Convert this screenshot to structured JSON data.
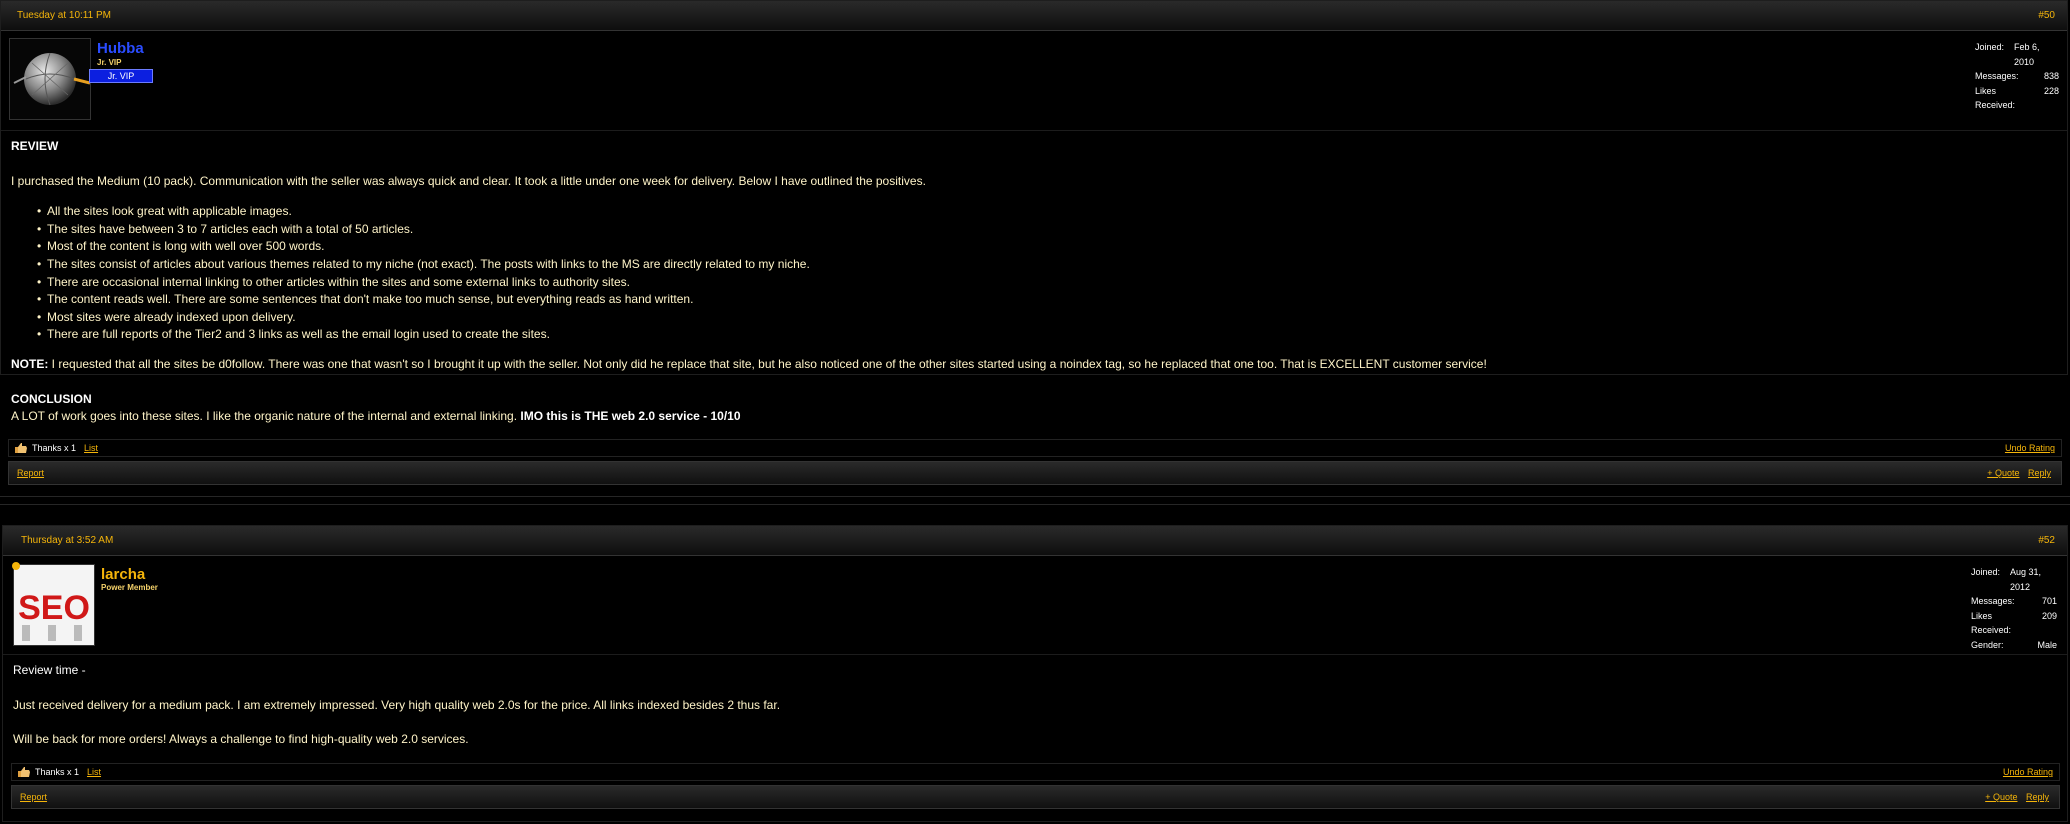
{
  "posts": [
    {
      "date": "Tuesday at 10:11 PM",
      "number": "#50",
      "username": "Hubba",
      "username_color": "#2a4cff",
      "user_title": "Jr. VIP",
      "rank_badge": "Jr. VIP",
      "stats": [
        {
          "label": "Joined:",
          "value": "Feb 6, 2010"
        },
        {
          "label": "Messages:",
          "value": "838"
        },
        {
          "label": "Likes Received:",
          "value": "228"
        }
      ],
      "review_heading": "REVIEW",
      "intro": "I purchased the Medium (10 pack). Communication with the seller was always quick and clear. It took a little under one week for delivery. Below I have outlined the positives.",
      "positives": [
        "All the sites look great with applicable images.",
        "The sites have between 3 to 7 articles each with a total of 50 articles.",
        "Most of the content is long with well over 500 words.",
        "The sites consist of articles about various themes related to my niche (not exact). The posts with links to the MS are directly related to my niche.",
        "There are occasional internal linking to other articles within the sites and some external links to authority sites.",
        "The content reads well. There are some sentences that don't make too much sense, but everything reads as hand written.",
        "Most sites were already indexed upon delivery.",
        "There are full reports of the Tier2 and 3 links as well as the email login used to create the sites."
      ],
      "note_label": "NOTE:",
      "note_text": " I requested that all the sites be d0follow. There was one that wasn't so I brought it up with the seller. Not only did he replace that site, but he also noticed one of the other sites started using a noindex tag, so he replaced that one too. That is EXCELLENT customer service!",
      "conclusion_heading": "CONCLUSION",
      "conclusion_text": "A LOT of work goes into these sites. I like the organic nature of the internal and external linking. ",
      "conclusion_bold": "IMO this is THE web 2.0 service - 10/10",
      "thanks": "Thanks x 1",
      "list_link": "List",
      "undo_rating": "Undo Rating",
      "report": "Report",
      "quote": "+ Quote",
      "reply": "Reply"
    },
    {
      "date": "Thursday at 3:52 AM",
      "number": "#52",
      "username": "larcha",
      "username_color": "#f5b50a",
      "user_title": "Power Member",
      "avatar_text": "SEO",
      "stats": [
        {
          "label": "Joined:",
          "value": "Aug 31, 2012"
        },
        {
          "label": "Messages:",
          "value": "701"
        },
        {
          "label": "Likes Received:",
          "value": "209"
        },
        {
          "label": "Gender:",
          "value": "Male"
        }
      ],
      "line1": "Review time -",
      "line2": "Just received delivery for a medium pack. I am extremely impressed. Very high quality web 2.0s for the price. All links indexed besides 2 thus far.",
      "line3": "Will be back for more orders! Always a challenge to find high-quality web 2.0 services.",
      "thanks": "Thanks x 1",
      "list_link": "List",
      "undo_rating": "Undo Rating",
      "report": "Report",
      "quote": "+ Quote",
      "reply": "Reply"
    }
  ],
  "colors": {
    "accent": "#f5b50a",
    "body_text": "#fff4c8",
    "rank_badge": "#0c1fe0"
  }
}
